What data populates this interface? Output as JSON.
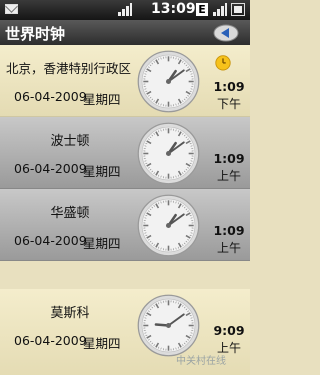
{
  "status": {
    "time": "13:09",
    "network_badge": "E"
  },
  "header": {
    "title": "世界时钟",
    "back_icon": "back-arrow-icon"
  },
  "clocks": [
    {
      "city": "北京，香港特别行政区",
      "date": "06-04-2009",
      "weekday": "星期四",
      "time": "1:09",
      "ampm": "下午",
      "alarm": true
    },
    {
      "city": "波士顿",
      "date": "06-04-2009",
      "weekday": "星期四",
      "time": "1:09",
      "ampm": "上午",
      "alarm": false
    },
    {
      "city": "华盛顿",
      "date": "06-04-2009",
      "weekday": "星期四",
      "time": "1:09",
      "ampm": "上午",
      "alarm": false
    },
    {
      "city": "莫斯科",
      "date": "06-04-2009",
      "weekday": "星期四",
      "time": "9:09",
      "ampm": "上午",
      "alarm": false
    }
  ],
  "watermark": "中关村在线"
}
